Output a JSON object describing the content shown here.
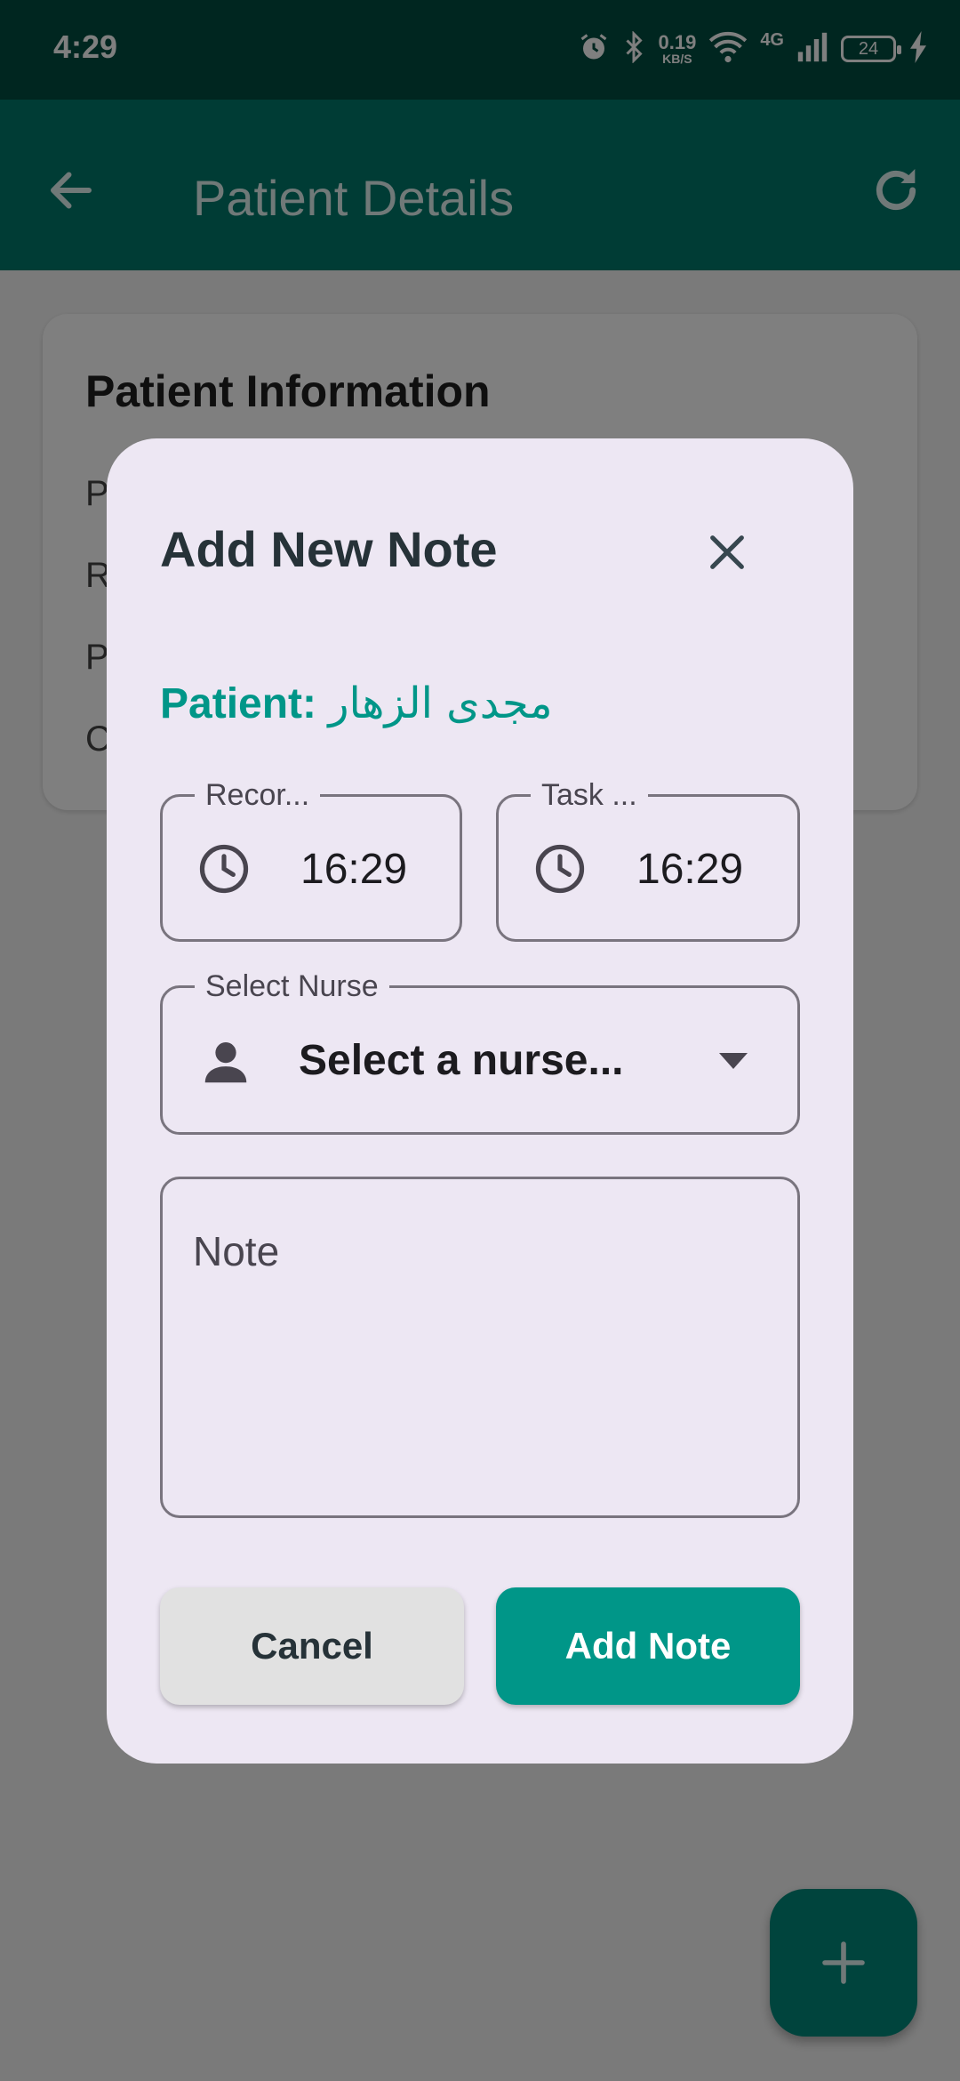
{
  "status_bar": {
    "time": "4:29",
    "speed_value": "0.19",
    "speed_unit": "KB/S",
    "network_type": "4G",
    "battery_level": "24"
  },
  "app_bar": {
    "title": "Patient Details"
  },
  "background_card": {
    "title": "Patient Information",
    "row_initials": [
      "P",
      "R",
      "P",
      "C"
    ]
  },
  "dialog": {
    "title": "Add New Note",
    "patient_label": "Patient:",
    "patient_name": "مجدى الزهار",
    "record_time": {
      "label": "Recor...",
      "value": "16:29"
    },
    "task_time": {
      "label": "Task ...",
      "value": "16:29"
    },
    "nurse_select": {
      "label": "Select Nurse",
      "value": "Select a nurse..."
    },
    "note_field": {
      "placeholder": "Note"
    },
    "cancel_label": "Cancel",
    "add_label": "Add Note"
  },
  "colors": {
    "status_bar": "#004d40",
    "app_bar": "#00796b",
    "accent": "#009688",
    "dialog_bg": "#ede7f3"
  }
}
